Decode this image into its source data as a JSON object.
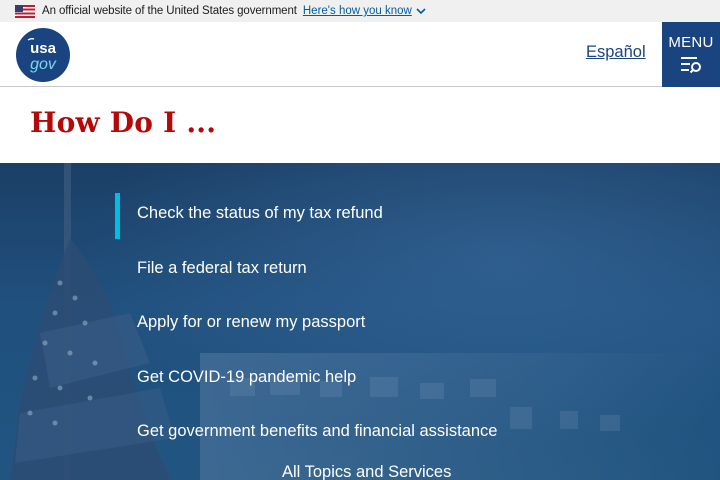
{
  "gov_banner": {
    "text": "An official website of the United States government",
    "link_label": "Here's how you know"
  },
  "header": {
    "logo_top": "usa",
    "logo_bottom": "gov",
    "language_link": "Español",
    "menu_label": "MENU"
  },
  "page": {
    "title": "How Do I ..."
  },
  "hero": {
    "items": [
      {
        "label": "Check the status of my tax refund"
      },
      {
        "label": "File a federal tax return"
      },
      {
        "label": "Apply for or renew my passport"
      },
      {
        "label": "Get COVID-19 pandemic help"
      },
      {
        "label": "Get government benefits and financial assistance"
      }
    ],
    "all_topics_label": "All Topics and Services"
  },
  "colors": {
    "brand_blue": "#1a4480",
    "title_red": "#b50909",
    "accent_cyan": "#00bde3"
  }
}
